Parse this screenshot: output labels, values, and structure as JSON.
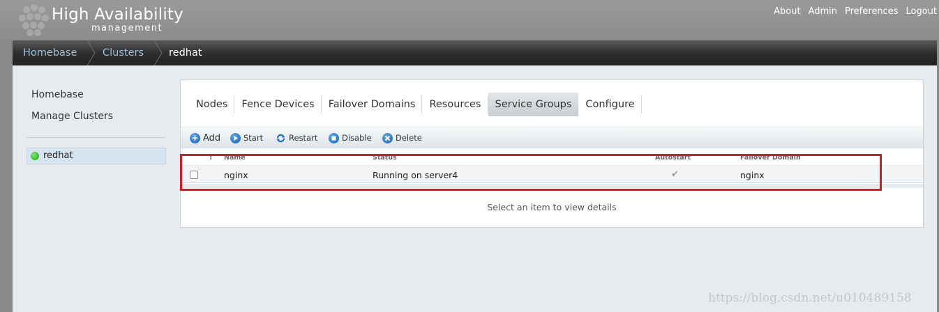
{
  "header": {
    "brand_title": "High Availability",
    "brand_subtitle": "management",
    "links": [
      "About",
      "Admin",
      "Preferences",
      "Logout"
    ]
  },
  "breadcrumb": {
    "items": [
      "Homebase",
      "Clusters"
    ],
    "current": "redhat"
  },
  "sidebar": {
    "links": [
      "Homebase",
      "Manage Clusters"
    ],
    "cluster": {
      "name": "redhat",
      "status_color": "#2db52a"
    }
  },
  "tabs": {
    "items": [
      "Nodes",
      "Fence Devices",
      "Failover Domains",
      "Resources",
      "Service Groups",
      "Configure"
    ],
    "active": "Service Groups"
  },
  "toolbar": {
    "buttons": [
      {
        "label": "Add",
        "icon": "plus-icon"
      },
      {
        "label": "Start",
        "icon": "play-icon"
      },
      {
        "label": "Restart",
        "icon": "refresh-icon"
      },
      {
        "label": "Disable",
        "icon": "stop-icon"
      },
      {
        "label": "Delete",
        "icon": "delete-icon"
      }
    ]
  },
  "table": {
    "columns": [
      "!",
      "Name",
      "Status",
      "Autostart",
      "Failover Domain"
    ],
    "rows": [
      {
        "name": "nginx",
        "status": "Running on server4",
        "autostart": true,
        "failover_domain": "nginx"
      }
    ]
  },
  "details": {
    "empty_message": "Select an item to view details"
  },
  "watermark": "https://blog.csdn.net/u010489158",
  "colors": {
    "highlight": "#e0141e",
    "link": "#9fc2dc",
    "active_tab": "#d3d7da"
  }
}
